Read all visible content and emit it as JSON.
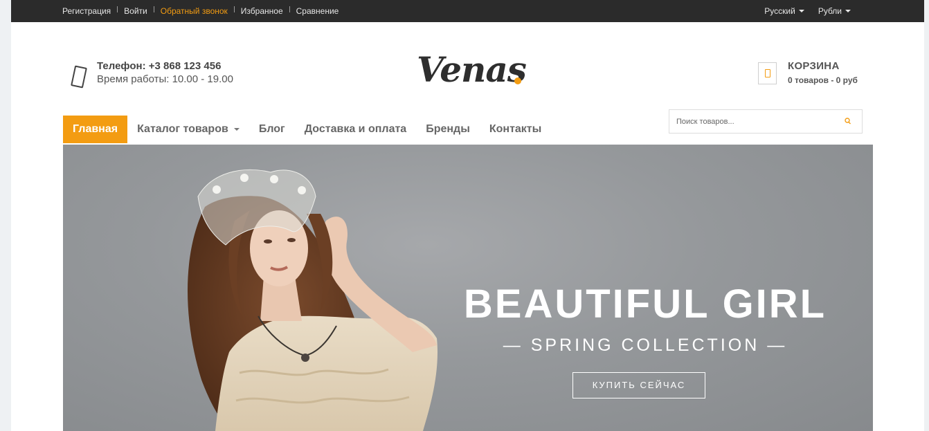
{
  "topbar": {
    "links": [
      "Регистрация",
      "Войти",
      "Обратный звонок",
      "Избранное",
      "Сравнение"
    ],
    "language": "Русский",
    "currency": "Рубли",
    "accent_color": "#f39c12"
  },
  "header": {
    "phone": "Телефон: +3 868 123 456",
    "hours": "Время работы: 10.00 - 19.00",
    "logo_text": "Venas",
    "cart_title": "КОРЗИНА",
    "cart_count": "0 товаров - 0 руб"
  },
  "nav": {
    "home": "Главная",
    "catalog": "Каталог товаров",
    "blog": "Блог",
    "delivery": "Доставка и оплата",
    "brands": "Бренды",
    "contacts": "Контакты"
  },
  "search": {
    "placeholder": "Поиск товаров...",
    "icon": "search-icon"
  },
  "hero": {
    "title": "BEAUTIFUL GIRL",
    "subtitle": "— SPRING COLLECTION —",
    "button": "КУПИТЬ СЕЙЧАС"
  }
}
